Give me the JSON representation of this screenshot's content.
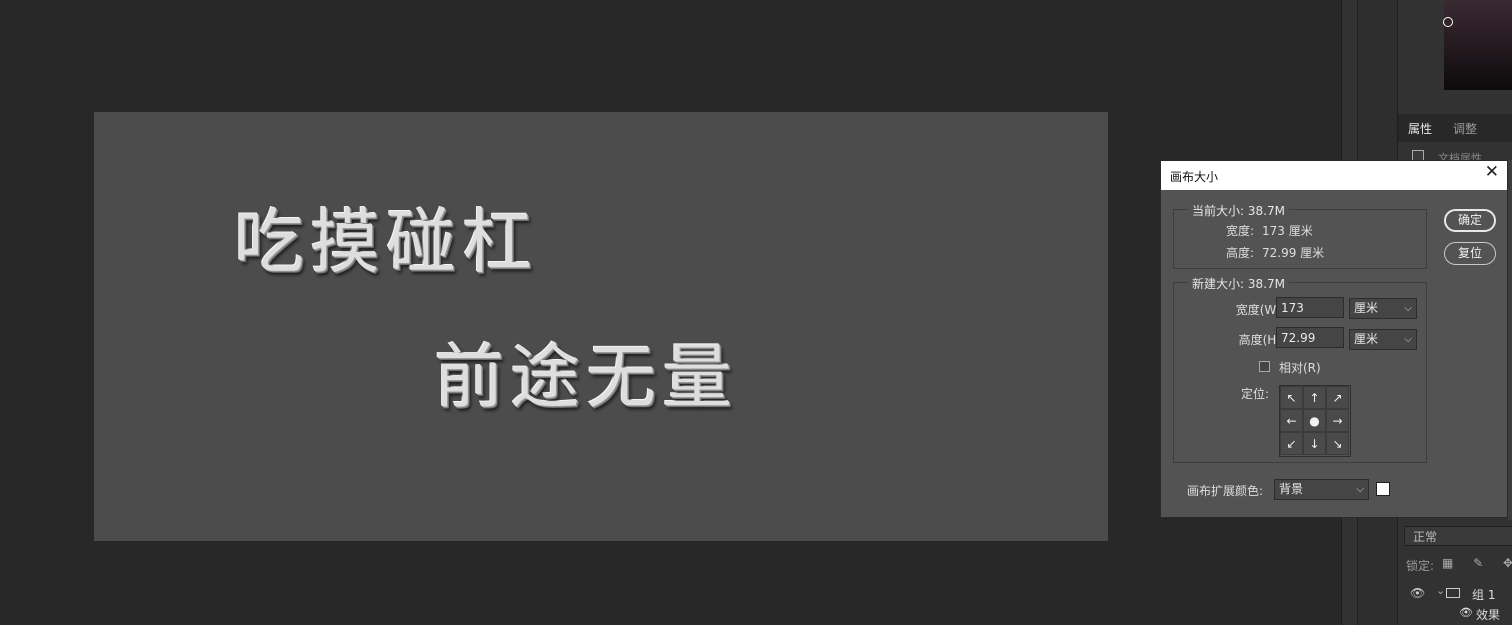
{
  "canvas": {
    "line1": "吃摸碰杠",
    "line2": "前途无量"
  },
  "right_panel": {
    "tab_properties": "属性",
    "tab_adjust": "调整",
    "doc_props_label": "文档属性",
    "blend_mode": "正常",
    "lock_label": "锁定:",
    "lock_icons": "▦ ✎ ✥ ⧉",
    "layer_group": "组 1",
    "sub_layer": "效果"
  },
  "dialog": {
    "title": "画布大小",
    "close": "✕",
    "ok": "确定",
    "reset": "复位",
    "current_size_legend": "当前大小: 38.7M",
    "current_width_label": "宽度:",
    "current_width_value": "173 厘米",
    "current_height_label": "高度:",
    "current_height_value": "72.99 厘米",
    "new_size_legend": "新建大小: 38.7M",
    "width_label": "宽度(W):",
    "width_value": "173",
    "width_unit": "厘米",
    "height_label": "高度(H):",
    "height_value": "72.99",
    "height_unit": "厘米",
    "relative_label": "相对(R)",
    "anchor_label": "定位:",
    "anchor_arrows": [
      "↖",
      "↑",
      "↗",
      "←",
      "●",
      "→",
      "↙",
      "↓",
      "↘"
    ],
    "extension_color_label": "画布扩展颜色:",
    "extension_color_value": "背景",
    "swatch_color": "#ffffff"
  }
}
